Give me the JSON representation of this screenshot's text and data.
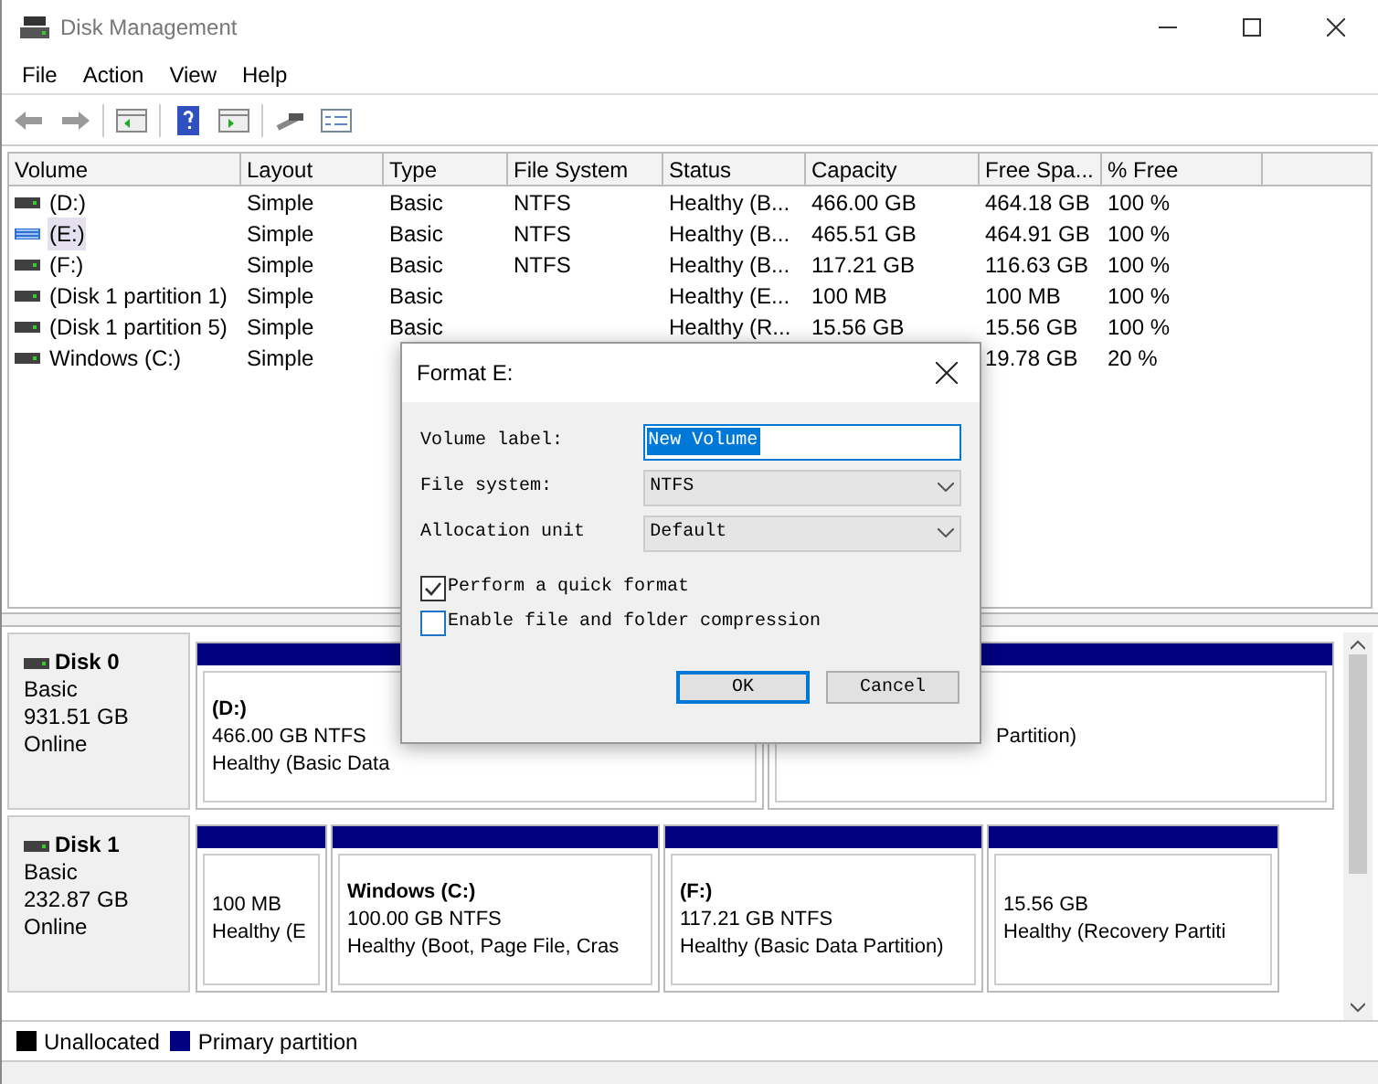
{
  "window": {
    "title": "Disk Management"
  },
  "menu": [
    "File",
    "Action",
    "View",
    "Help"
  ],
  "table": {
    "columns": [
      "Volume",
      "Layout",
      "Type",
      "File System",
      "Status",
      "Capacity",
      "Free Spa...",
      "% Free"
    ],
    "rows": [
      {
        "selected": false,
        "cells": [
          "(D:)",
          "Simple",
          "Basic",
          "NTFS",
          "Healthy (B...",
          "466.00 GB",
          "464.18 GB",
          "100 %"
        ]
      },
      {
        "selected": true,
        "cells": [
          "(E:)",
          "Simple",
          "Basic",
          "NTFS",
          "Healthy (B...",
          "465.51 GB",
          "464.91 GB",
          "100 %"
        ]
      },
      {
        "selected": false,
        "cells": [
          "(F:)",
          "Simple",
          "Basic",
          "NTFS",
          "Healthy (B...",
          "117.21 GB",
          "116.63 GB",
          "100 %"
        ]
      },
      {
        "selected": false,
        "cells": [
          "(Disk 1 partition 1)",
          "Simple",
          "Basic",
          "",
          "Healthy (E...",
          "100 MB",
          "100 MB",
          "100 %"
        ]
      },
      {
        "selected": false,
        "cells": [
          "(Disk 1 partition 5)",
          "Simple",
          "Basic",
          "",
          "Healthy (R...",
          "15.56 GB",
          "15.56 GB",
          "100 %"
        ]
      },
      {
        "selected": false,
        "cells": [
          "Windows (C:)",
          "Simple",
          "",
          "",
          "",
          "",
          "19.78 GB",
          "20 %"
        ]
      }
    ]
  },
  "disks": [
    {
      "name": "Disk 0",
      "type": "Basic",
      "size": "931.51 GB",
      "state": "Online",
      "partitions": [
        {
          "title": "(D:)",
          "size": "466.00 GB NTFS",
          "status": "Healthy (Basic Data"
        },
        {
          "status": "Partition)"
        }
      ]
    },
    {
      "name": "Disk 1",
      "type": "Basic",
      "size": "232.87 GB",
      "state": "Online",
      "partitions": [
        {
          "size": "100 MB",
          "status": "Healthy (E"
        },
        {
          "title": "Windows  (C:)",
          "size": "100.00 GB NTFS",
          "status": "Healthy (Boot, Page File, Cras"
        },
        {
          "title": "(F:)",
          "size": "117.21 GB NTFS",
          "status": "Healthy (Basic Data Partition)"
        },
        {
          "size": "15.56 GB",
          "status": "Healthy (Recovery Partiti"
        }
      ]
    }
  ],
  "legend": [
    {
      "label": "Unallocated",
      "color": "#000000"
    },
    {
      "label": "Primary partition",
      "color": "#000080"
    }
  ],
  "dialog": {
    "title": "Format E:",
    "fields": [
      {
        "kind": "text",
        "label": "Volume label:",
        "value": "New Volume"
      },
      {
        "kind": "select",
        "label": "File system:",
        "value": "NTFS"
      },
      {
        "kind": "select",
        "label": "Allocation unit",
        "value": "Default"
      }
    ],
    "options": [
      {
        "label": "Perform a quick format",
        "checked": true
      },
      {
        "label": "Enable file and folder compression",
        "checked": false
      }
    ],
    "buttons": [
      {
        "label": "OK",
        "selected": true
      },
      {
        "label": "Cancel",
        "selected": false
      }
    ]
  }
}
